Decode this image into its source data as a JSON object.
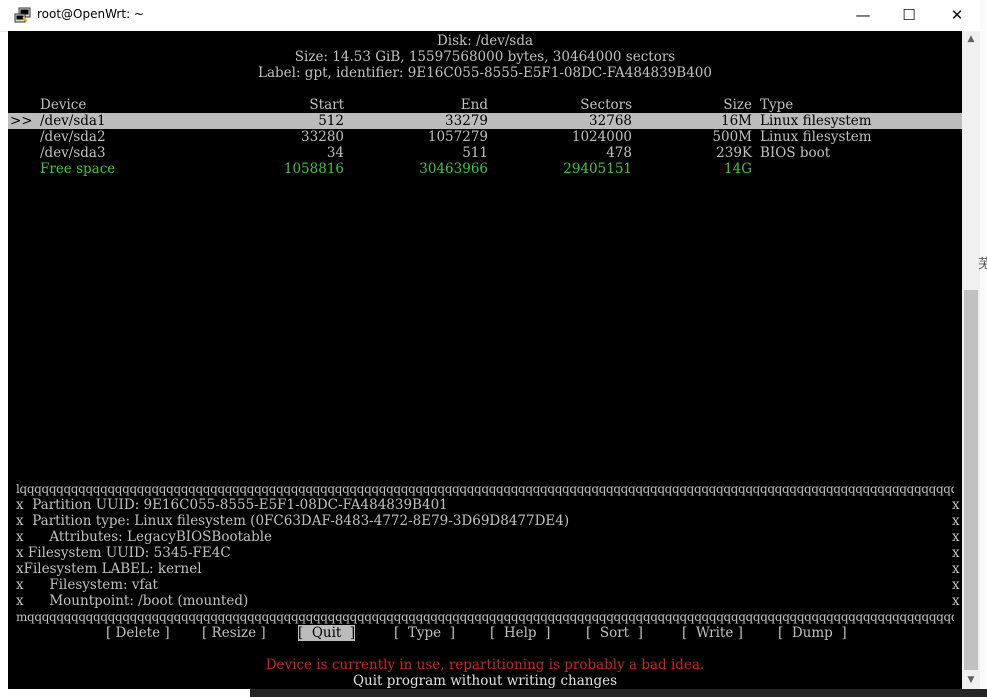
{
  "window": {
    "title": "root@OpenWrt: ~",
    "minimize": "—",
    "maximize": "☐",
    "close": "✕"
  },
  "disk": {
    "header": "Disk: /dev/sda",
    "size_line": "Size: 14.53 GiB, 15597568000 bytes, 30464000 sectors",
    "label_line": "Label: gpt, identifier: 9E16C055-8555-E5F1-08DC-FA484839B400"
  },
  "table": {
    "headers": {
      "device": "Device",
      "start": "Start",
      "end": "End",
      "sectors": "Sectors",
      "size": "Size",
      "type": "Type"
    },
    "selector": ">>",
    "rows": [
      {
        "device": "/dev/sda1",
        "start": "512",
        "end": "33279",
        "sectors": "32768",
        "size": "16M",
        "type": "Linux filesystem"
      },
      {
        "device": "/dev/sda2",
        "start": "33280",
        "end": "1057279",
        "sectors": "1024000",
        "size": "500M",
        "type": "Linux filesystem"
      },
      {
        "device": "/dev/sda3",
        "start": "34",
        "end": "511",
        "sectors": "478",
        "size": "239K",
        "type": "BIOS boot"
      },
      {
        "device": "Free space",
        "start": "1058816",
        "end": "30463966",
        "sectors": "29405151",
        "size": "14G",
        "type": ""
      }
    ]
  },
  "info_box": {
    "top_border": "lqqqqqqqqqqqqqqqqqqqqqqqqqqqqqqqqqqqqqqqqqqqqqqqqqqqqqqqqqqqqqqqqqqqqqqqqqqqqqqqqqqqqqqqqqqqqqqqqqqqqqqqqqqqqqqqqqqqqqqqqqqqqqqqqqqqqqqqqqqqqqqqqqqqqqqk",
    "bottom_border": "mqqqqqqqqqqqqqqqqqqqqqqqqqqqqqqqqqqqqqqqqqqqqqqqqqqqqqqqqqqqqqqqqqqqqqqqqqqqqqqqqqqqqqqqqqqqqqqqqqqqqqqqqqqqqqqqqqqqqqqqqqqqqqqqqqqqqqqqqqqqqqqqqqqqqqqj",
    "side_char": "x",
    "lines": [
      "x  Partition UUID: 9E16C055-8555-E5F1-08DC-FA484839B401",
      "x  Partition type: Linux filesystem (0FC63DAF-8483-4772-8E79-3D69D8477DE4)",
      "x      Attributes: LegacyBIOSBootable",
      "x Filesystem UUID: 5345-FE4C",
      "xFilesystem LABEL: kernel",
      "x      Filesystem: vfat",
      "x      Mountpoint: /boot (mounted)"
    ]
  },
  "menu": [
    {
      "label": "[ Delete ]",
      "active": false
    },
    {
      "label": "[ Resize ]",
      "active": false
    },
    {
      "label": "[  Quit  ]",
      "active": true
    },
    {
      "label": "[  Type  ]",
      "active": false
    },
    {
      "label": "[  Help  ]",
      "active": false
    },
    {
      "label": "[  Sort  ]",
      "active": false
    },
    {
      "label": "[  Write ]",
      "active": false
    },
    {
      "label": "[  Dump  ]",
      "active": false
    }
  ],
  "warning": "Device is currently in use, repartitioning is probably a bad idea.",
  "hint": "Quit program without writing changes",
  "scrollbar": {
    "up": "▲",
    "down": "▼"
  },
  "edge_glyph": "芜",
  "colors": {
    "free": "#3cc43c",
    "warning": "#cc2222",
    "selection": "#bcbcbc"
  }
}
